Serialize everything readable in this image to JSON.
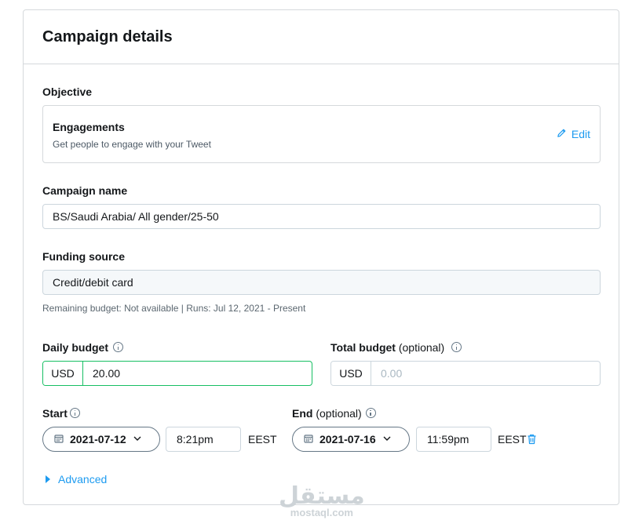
{
  "header": {
    "title": "Campaign details"
  },
  "objective": {
    "label": "Objective",
    "title": "Engagements",
    "subtitle": "Get people to engage with your Tweet",
    "edit_label": "Edit",
    "edit_icon": "pencil-icon"
  },
  "campaign_name": {
    "label": "Campaign name",
    "value": "BS/Saudi Arabia/ All gender/25-50"
  },
  "funding_source": {
    "label": "Funding source",
    "value": "Credit/debit card",
    "helper": "Remaining budget: Not available | Runs: Jul 12, 2021 - Present"
  },
  "daily_budget": {
    "label": "Daily budget",
    "currency": "USD",
    "value": "20.00"
  },
  "total_budget": {
    "label": "Total budget",
    "optional": "(optional)",
    "currency": "USD",
    "placeholder": "0.00"
  },
  "start": {
    "label": "Start",
    "date": "2021-07-12",
    "time": "8:21pm",
    "timezone": "EEST"
  },
  "end": {
    "label": "End",
    "optional": "(optional)",
    "date": "2021-07-16",
    "time": "11:59pm",
    "timezone": "EEST"
  },
  "advanced": {
    "label": "Advanced"
  },
  "watermark": {
    "arabic": "مستقل",
    "latin": "mostaql.com"
  },
  "colors": {
    "accent": "#1d9bf0",
    "active_border": "#17bf63",
    "border": "#ccd6dd"
  }
}
